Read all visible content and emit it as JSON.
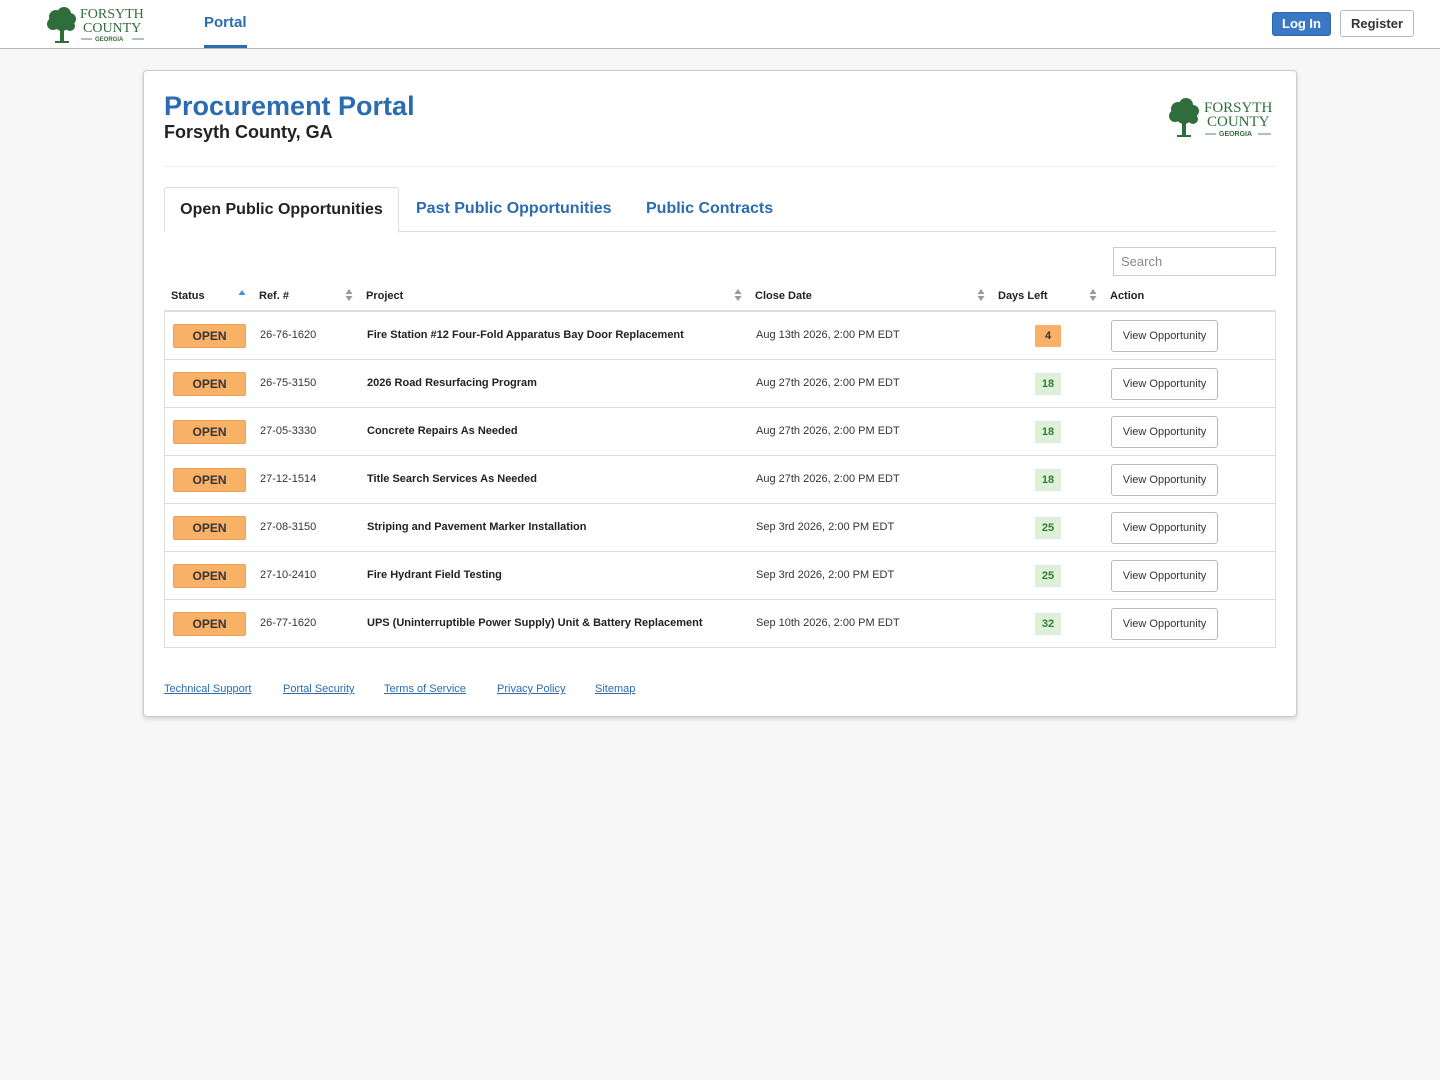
{
  "brand": {
    "line1": "FORSYTH",
    "line2": "COUNTY",
    "line3": "GEORGIA",
    "green": "#2f6d3b"
  },
  "topnav": {
    "portal": "Portal",
    "login": "Log In",
    "register": "Register"
  },
  "header": {
    "title": "Procurement Portal",
    "subtitle": "Forsyth County, GA"
  },
  "tabs": [
    {
      "label": "Open Public Opportunities",
      "active": true
    },
    {
      "label": "Past Public Opportunities",
      "active": false
    },
    {
      "label": "Public Contracts",
      "active": false
    }
  ],
  "search": {
    "placeholder": "Search"
  },
  "table": {
    "columns": [
      "Status",
      "Ref. #",
      "Project",
      "Close Date",
      "Days Left",
      "Action"
    ],
    "rows": [
      {
        "status": "OPEN",
        "ref": "26-76-1620",
        "project": "Fire Station #12 Four-Fold Apparatus Bay Door Replacement",
        "close": "Aug 13th 2026, 2:00 PM EDT",
        "days": "4",
        "urgent": true,
        "action": "View Opportunity"
      },
      {
        "status": "OPEN",
        "ref": "26-75-3150",
        "project": "2026 Road Resurfacing Program",
        "close": "Aug 27th 2026, 2:00 PM EDT",
        "days": "18",
        "urgent": false,
        "action": "View Opportunity"
      },
      {
        "status": "OPEN",
        "ref": "27-05-3330",
        "project": "Concrete Repairs As Needed",
        "close": "Aug 27th 2026, 2:00 PM EDT",
        "days": "18",
        "urgent": false,
        "action": "View Opportunity"
      },
      {
        "status": "OPEN",
        "ref": "27-12-1514",
        "project": "Title Search Services As Needed",
        "close": "Aug 27th 2026, 2:00 PM EDT",
        "days": "18",
        "urgent": false,
        "action": "View Opportunity"
      },
      {
        "status": "OPEN",
        "ref": "27-08-3150",
        "project": "Striping and Pavement Marker Installation",
        "close": "Sep 3rd 2026, 2:00 PM EDT",
        "days": "25",
        "urgent": false,
        "action": "View Opportunity"
      },
      {
        "status": "OPEN",
        "ref": "27-10-2410",
        "project": "Fire Hydrant Field Testing",
        "close": "Sep 3rd 2026, 2:00 PM EDT",
        "days": "25",
        "urgent": false,
        "action": "View Opportunity"
      },
      {
        "status": "OPEN",
        "ref": "26-77-1620",
        "project": "UPS (Uninterruptible Power Supply) Unit & Battery Replacement",
        "close": "Sep 10th 2026, 2:00 PM EDT",
        "days": "32",
        "urgent": false,
        "action": "View Opportunity"
      }
    ]
  },
  "footer": {
    "links": [
      "Technical Support",
      "Portal Security",
      "Terms of Service",
      "Privacy Policy",
      "Sitemap"
    ]
  }
}
